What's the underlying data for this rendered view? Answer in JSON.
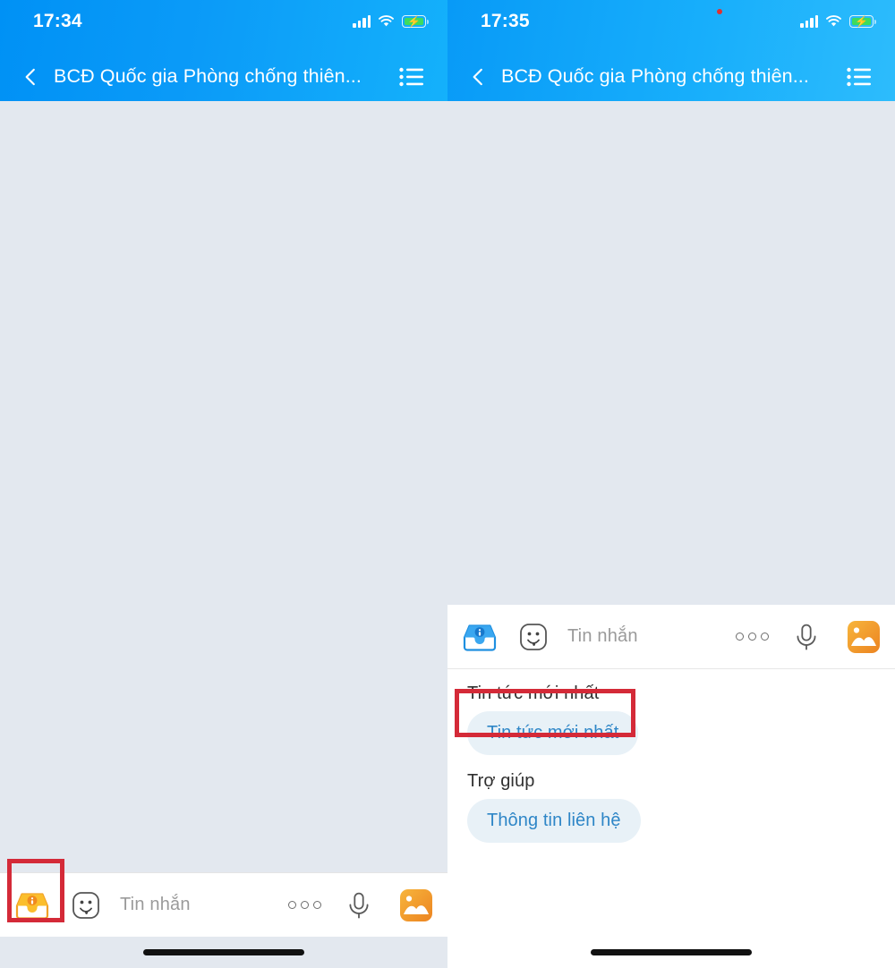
{
  "screens": [
    {
      "id": "before",
      "status": {
        "time": "17:34",
        "signal_icon": "cellular-bars-icon",
        "wifi_icon": "wifi-icon",
        "battery_icon": "battery-charging-icon"
      },
      "navbar": {
        "back_icon": "chevron-left-icon",
        "title": "BCĐ Quốc gia Phòng chống thiên...",
        "menu_icon": "list-menu-icon",
        "has_red_dot": false
      },
      "inputbar": {
        "inbox_icon": "inbox-menu-icon",
        "inbox_icon_color": "#F2A127",
        "smiley_icon": "smiley-tongue-icon",
        "placeholder": "Tin nhắn",
        "more_icon": "three-dots-icon",
        "mic_icon": "microphone-icon",
        "photo_icon": "photo-gallery-icon"
      },
      "highlight": {
        "target": "inbox-menu-icon",
        "color": "#D42A38"
      },
      "sheet_open": false
    },
    {
      "id": "after",
      "status": {
        "time": "17:35",
        "signal_icon": "cellular-bars-icon",
        "wifi_icon": "wifi-icon",
        "battery_icon": "battery-charging-icon"
      },
      "navbar": {
        "back_icon": "chevron-left-icon",
        "title": "BCĐ Quốc gia Phòng chống thiên...",
        "menu_icon": "list-menu-icon",
        "has_red_dot": true
      },
      "inputbar": {
        "inbox_icon": "inbox-menu-icon",
        "inbox_icon_color": "#1E8FE0",
        "smiley_icon": "smiley-tongue-icon",
        "placeholder": "Tin nhắn",
        "more_icon": "three-dots-icon",
        "mic_icon": "microphone-icon",
        "photo_icon": "photo-gallery-icon"
      },
      "highlight": {
        "target": "chip-tin-tuc-moi-nhat",
        "color": "#D42A38"
      },
      "sheet_open": true,
      "menu": {
        "sections": [
          {
            "title": "Tin tức mới nhất",
            "chips": [
              "Tin tức mới nhất"
            ]
          },
          {
            "title": "Trợ giúp",
            "chips": [
              "Thông tin liên hệ"
            ]
          }
        ]
      }
    }
  ],
  "colors": {
    "header_blue_dark": "#0091F5",
    "header_blue_light": "#2DBCFC",
    "chat_background": "#E3E8EF",
    "chip_background": "#E8F1F7",
    "chip_text": "#2E86C7",
    "highlight_red": "#D42A38",
    "battery_green": "#3DDB5F",
    "inbox_orange": "#F2A127",
    "inbox_blue": "#1E8FE0"
  }
}
